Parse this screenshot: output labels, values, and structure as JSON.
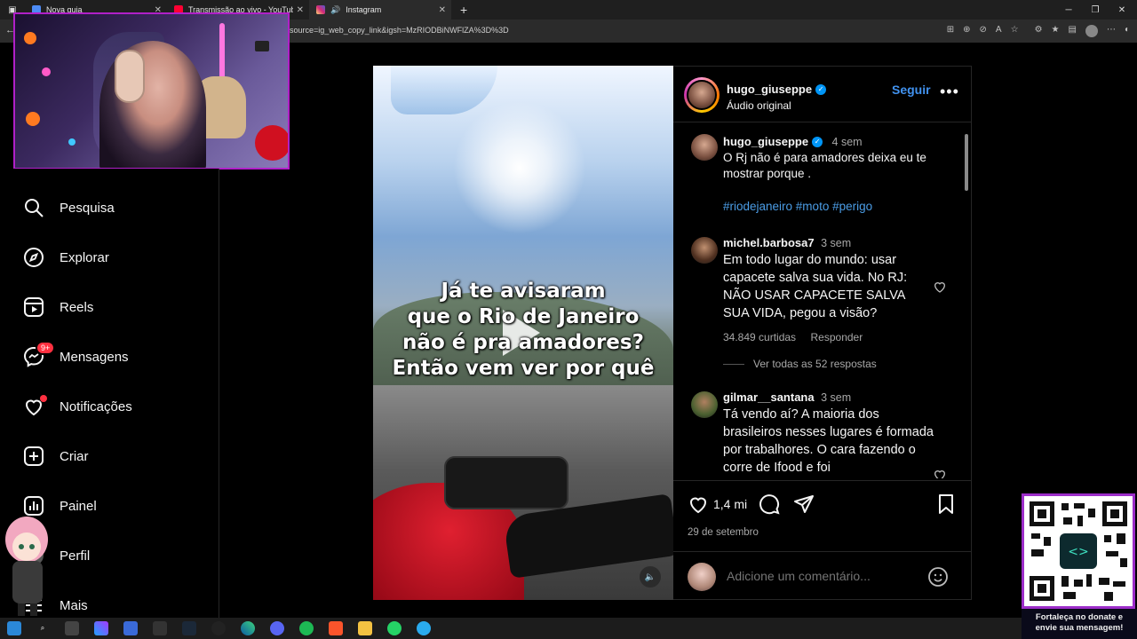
{
  "browser": {
    "tabs": [
      {
        "label": "Nova guia",
        "icon": "new-tab-icon",
        "color": "#4c8bf5"
      },
      {
        "label": "Transmissão ao vivo - YouTube St",
        "icon": "youtube-icon",
        "color": "#ff0033"
      },
      {
        "label": "Instagram",
        "icon": "instagram-icon",
        "color": "#dd2a7b"
      }
    ],
    "new_tab": "+",
    "url": "source=ig_web_copy_link&igsh=MzRIODBiNWFlZA%3D%3D"
  },
  "nav": {
    "items": [
      {
        "label": "Pesquisa",
        "icon": "search-icon"
      },
      {
        "label": "Explorar",
        "icon": "compass-icon"
      },
      {
        "label": "Reels",
        "icon": "reels-icon"
      },
      {
        "label": "Mensagens",
        "icon": "messenger-icon",
        "badge": "9+"
      },
      {
        "label": "Notificações",
        "icon": "heart-icon"
      },
      {
        "label": "Criar",
        "icon": "plus-square-icon"
      },
      {
        "label": "Painel",
        "icon": "dashboard-icon"
      },
      {
        "label": "Perfil",
        "icon": "profile-icon"
      },
      {
        "label": "Mais",
        "icon": "menu-icon"
      }
    ]
  },
  "post": {
    "caption_lines": [
      "Já te avisaram",
      "que o Rio de Janeiro",
      "não é pra amadores?",
      "Então vem ver por quê"
    ],
    "author": "hugo_giuseppe",
    "audio": "Áudio original",
    "follow_label": "Seguir",
    "more_label": "•••",
    "description": {
      "username": "hugo_giuseppe",
      "time": "4 sem",
      "text": "O Rj não é para amadores deixa eu te mostrar porque .",
      "hashtags": "#riodejaneiro #moto #perigo"
    },
    "comments": [
      {
        "username": "michel.barbosa7",
        "time": "3 sem",
        "text": "Em todo lugar do mundo: usar capacete salva sua vida. No RJ: NÃO USAR CAPACETE SALVA SUA VIDA, pegou a visão?",
        "likes": "34.849 curtidas",
        "reply": "Responder",
        "view_replies": "Ver todas as 52 respostas"
      },
      {
        "username": "gilmar__santana",
        "time": "3 sem",
        "text": "Tá vendo aí? A maioria dos brasileiros nesses lugares é formada por trabalhores. O cara fazendo o corre de Ifood e foi"
      }
    ],
    "likes": "1,4 mi",
    "date": "29 de setembro",
    "add_comment_placeholder": "Adicione um comentário..."
  },
  "qr": {
    "caption_line1": "Fortaleça no donate e",
    "caption_line2": "envie sua mensagem!"
  },
  "colors": {
    "accent_blue": "#4192ef",
    "verified": "#0095f6",
    "notification_red": "#ff3040",
    "qr_border": "#9c2dc9"
  }
}
